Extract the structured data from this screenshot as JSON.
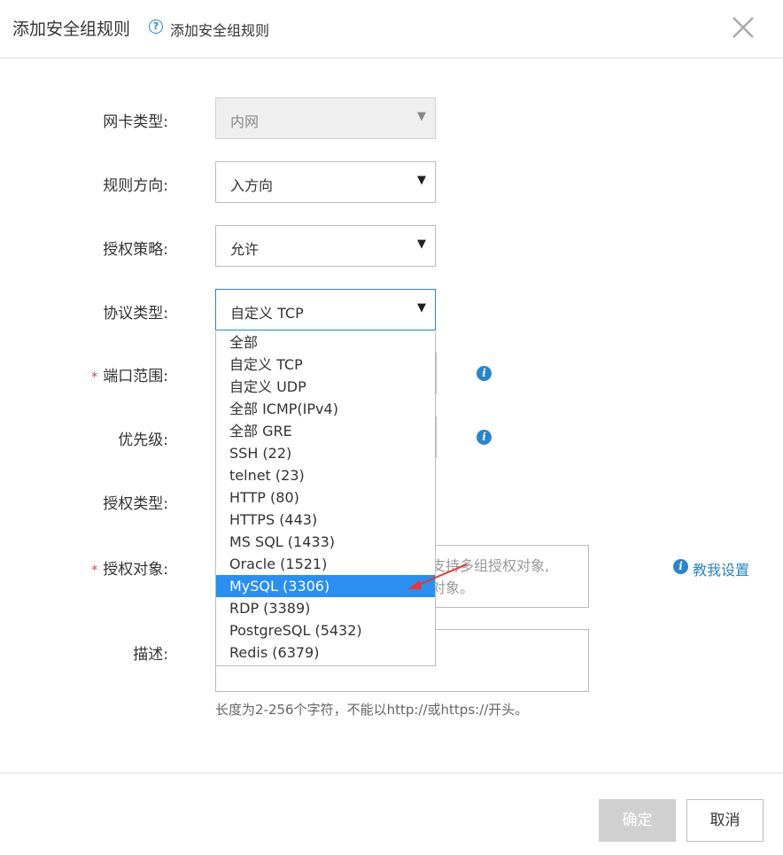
{
  "header": {
    "title": "添加安全组规则",
    "help_link": "添加安全组规则"
  },
  "form": {
    "nic_type": {
      "label": "网卡类型:",
      "value": "内网"
    },
    "direction": {
      "label": "规则方向:",
      "value": "入方向"
    },
    "policy": {
      "label": "授权策略:",
      "value": "允许"
    },
    "protocol": {
      "label": "协议类型:",
      "value": "自定义 TCP"
    },
    "port_range": {
      "label": "端口范围:",
      "required_mark": "*"
    },
    "priority": {
      "label": "优先级:"
    },
    "auth_type": {
      "label": "授权类型:"
    },
    "auth_object": {
      "label": "授权对象:",
      "required_mark": "*",
      "placeholder_line1": "支持多组授权对象,",
      "placeholder_line2": "对象。",
      "teach_link": "教我设置"
    },
    "description": {
      "label": "描述:",
      "hint": "长度为2-256个字符，不能以http://或https://开头。"
    }
  },
  "protocol_dropdown": {
    "options": [
      "全部",
      "自定义 TCP",
      "自定义 UDP",
      "全部 ICMP(IPv4)",
      "全部 GRE",
      "SSH (22)",
      "telnet (23)",
      "HTTP (80)",
      "HTTPS (443)",
      "MS SQL (1433)",
      "Oracle (1521)",
      "MySQL (3306)",
      "RDP (3389)",
      "PostgreSQL (5432)",
      "Redis (6379)"
    ],
    "highlighted": "MySQL (3306)"
  },
  "footer": {
    "confirm_label": "确定",
    "cancel_label": "取消"
  },
  "colors": {
    "accent": "#2a84c9",
    "highlight": "#2a8ff0",
    "required": "#e0353f",
    "annotation_arrow": "#e53935",
    "disabled_button": "#d0d0d0"
  }
}
